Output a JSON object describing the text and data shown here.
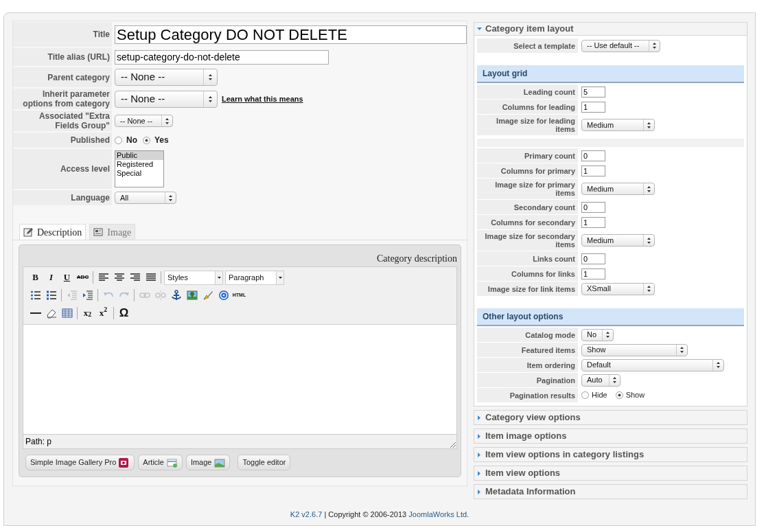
{
  "form": {
    "fields": [
      {
        "kind": "title",
        "label": "Title",
        "value": "Setup Category DO NOT DELETE"
      },
      {
        "kind": "text",
        "label": "Title alias (URL)",
        "value": "setup-category-do-not-delete"
      },
      {
        "kind": "bigselect",
        "label": "Parent category",
        "value": "-- None --"
      },
      {
        "kind": "bigselect",
        "label": "Inherit parameter options from category",
        "value": "-- None --",
        "link": "Learn what this means"
      },
      {
        "kind": "select",
        "label": "Associated \"Extra Fields Group\"",
        "value": "-- None --"
      },
      {
        "kind": "radio",
        "label": "Published",
        "options": [
          {
            "label": "No",
            "selected": false
          },
          {
            "label": "Yes",
            "selected": true
          }
        ]
      },
      {
        "kind": "listbox",
        "label": "Access level",
        "options": [
          {
            "label": "Public",
            "selected": true
          },
          {
            "label": "Registered",
            "selected": false
          },
          {
            "label": "Special",
            "selected": false
          }
        ]
      },
      {
        "kind": "select",
        "label": "Language",
        "value": "All"
      }
    ]
  },
  "tabs": [
    {
      "label": "Description",
      "selected": true
    },
    {
      "label": "Image",
      "selected": false
    }
  ],
  "editor": {
    "label": "Category description",
    "toolbar": [
      [
        {
          "kind": "glyph",
          "text": "B"
        },
        {
          "kind": "glyph",
          "text": "I"
        },
        {
          "kind": "glyph",
          "text": "U"
        },
        {
          "kind": "glyph",
          "text": "ABC"
        },
        {
          "kind": "sep"
        },
        {
          "kind": "icon",
          "disabled": false
        },
        {
          "kind": "icon",
          "disabled": false
        },
        {
          "kind": "icon",
          "disabled": false
        },
        {
          "kind": "icon",
          "disabled": false
        },
        {
          "kind": "sep"
        },
        {
          "kind": "dropdown",
          "text": "Styles"
        },
        {
          "kind": "dropdown",
          "text": "Paragraph"
        }
      ],
      [
        {
          "kind": "icon",
          "disabled": false
        },
        {
          "kind": "icon",
          "disabled": false
        },
        {
          "kind": "sep"
        },
        {
          "kind": "icon",
          "disabled": true
        },
        {
          "kind": "icon",
          "disabled": false
        },
        {
          "kind": "sep"
        },
        {
          "kind": "icon",
          "disabled": true
        },
        {
          "kind": "icon",
          "disabled": true
        },
        {
          "kind": "sep"
        },
        {
          "kind": "icon",
          "disabled": true
        },
        {
          "kind": "icon",
          "disabled": true
        },
        {
          "kind": "icon",
          "disabled": false
        },
        {
          "kind": "icon",
          "disabled": false
        },
        {
          "kind": "icon",
          "disabled": false
        },
        {
          "kind": "icon",
          "disabled": false
        },
        {
          "kind": "glyph",
          "text": "HTML"
        }
      ],
      [
        {
          "kind": "icon",
          "disabled": false
        },
        {
          "kind": "icon",
          "disabled": false
        },
        {
          "kind": "icon",
          "disabled": false
        },
        {
          "kind": "sep"
        },
        {
          "kind": "glyph",
          "text": "x$_{2}$"
        },
        {
          "kind": "glyph",
          "text": "x$^{2}$"
        },
        {
          "kind": "sep"
        },
        {
          "kind": "glyph",
          "text": "Ω"
        }
      ]
    ],
    "path": "Path: p",
    "buttons": [
      "Simple Image Gallery Pro",
      "Article",
      "Image",
      "Toggle editor"
    ]
  },
  "panels": [
    {
      "title": "Category item layout",
      "expanded": true,
      "sections": [
        {
          "groups": [
            [
              {
                "label": "Select a template",
                "kind": "select",
                "value": "-- Use default --"
              }
            ]
          ]
        },
        {
          "heading": "Layout grid",
          "groups": [
            [
              {
                "label": "Leading count",
                "kind": "input",
                "value": "5"
              },
              {
                "label": "Columns for leading",
                "kind": "input",
                "value": "1"
              },
              {
                "label": "Image size for leading items",
                "kind": "select",
                "value": "Medium"
              }
            ],
            [
              {
                "label": "Primary count",
                "kind": "input",
                "value": "0"
              },
              {
                "label": "Columns for primary",
                "kind": "input",
                "value": "1"
              },
              {
                "label": "Image size for primary items",
                "kind": "select",
                "value": "Medium"
              },
              {
                "label": "Secondary count",
                "kind": "input",
                "value": "0"
              },
              {
                "label": "Columns for secondary",
                "kind": "input",
                "value": "1"
              },
              {
                "label": "Image size for secondary items",
                "kind": "select",
                "value": "Medium"
              },
              {
                "label": "Links count",
                "kind": "input",
                "value": "0"
              },
              {
                "label": "Columns for links",
                "kind": "input",
                "value": "1"
              },
              {
                "label": "Image size for link items",
                "kind": "select",
                "value": "XSmall"
              }
            ]
          ]
        },
        {
          "heading": "Other layout options",
          "groups": [
            [
              {
                "label": "Catalog mode",
                "kind": "select",
                "value": "No"
              },
              {
                "label": "Featured items",
                "kind": "select",
                "value": "Show"
              },
              {
                "label": "Item ordering",
                "kind": "select",
                "value": "Default"
              },
              {
                "label": "Pagination",
                "kind": "select",
                "value": "Auto"
              },
              {
                "label": "Pagination results",
                "kind": "radio",
                "options": [
                  {
                    "label": "Hide",
                    "selected": false
                  },
                  {
                    "label": "Show",
                    "selected": true
                  }
                ]
              }
            ]
          ]
        }
      ]
    },
    {
      "title": "Category view options",
      "expanded": false
    },
    {
      "title": "Item image options",
      "expanded": false
    },
    {
      "title": "Item view options in category listings",
      "expanded": false
    },
    {
      "title": "Item view options",
      "expanded": false
    },
    {
      "title": "Metadata Information",
      "expanded": false
    }
  ],
  "footer": [
    {
      "text": "K2 v2.6.7",
      "link": true
    },
    {
      "text": "| Copyright © 2006-2013",
      "link": false
    },
    {
      "text": "JoomlaWorks Ltd.",
      "link": true
    }
  ]
}
